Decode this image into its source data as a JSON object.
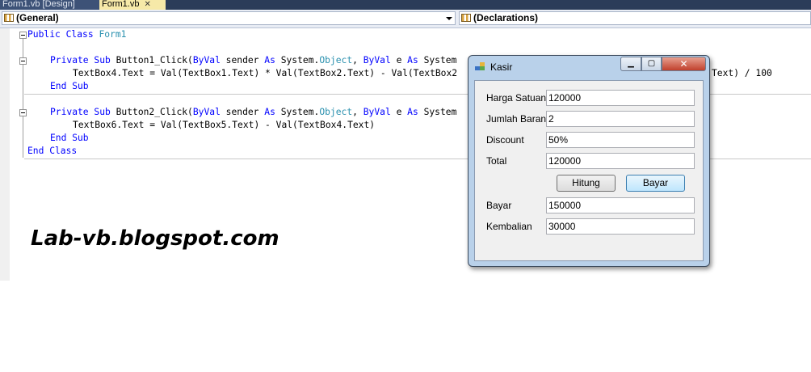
{
  "tabs": [
    {
      "label": "Form1.vb [Design]"
    },
    {
      "label": "Form1.vb"
    }
  ],
  "dropdowns": {
    "general": "(General)",
    "declarations": "(Declarations)"
  },
  "code": {
    "l1_kw": "Public Class",
    "l1_name": "Form1",
    "l3_a": "Private Sub",
    "l3_b": " Button1_Click(",
    "l3_c": "ByVal",
    "l3_d": " sender ",
    "l3_e": "As",
    "l3_f": " System.",
    "l3_g": "Object",
    "l3_h": ", ",
    "l3_i": "ByVal",
    "l3_j": " e ",
    "l3_k": "As",
    "l3_l": " System",
    "l4": "TextBox4.Text = Val(TextBox1.Text) * Val(TextBox2.Text) - Val(TextBox2",
    "l4_tail": "Text) / 100",
    "l5": "End Sub",
    "l7_a": "Private Sub",
    "l7_b": " Button2_Click(",
    "l7_c": "ByVal",
    "l7_d": " sender ",
    "l7_e": "As",
    "l7_f": " System.",
    "l7_g": "Object",
    "l7_h": ", ",
    "l7_i": "ByVal",
    "l7_j": " e ",
    "l7_k": "As",
    "l7_l": " System",
    "l8": "TextBox6.Text = Val(TextBox5.Text) - Val(TextBox4.Text)",
    "l9": "End Sub",
    "l10": "End Class"
  },
  "watermark": "Lab-vb.blogspot.com",
  "kasir": {
    "title": "Kasir",
    "fields": [
      {
        "label": "Harga Satuan",
        "value": "120000"
      },
      {
        "label": "Jumlah Barang",
        "value": "2"
      },
      {
        "label": "Discount",
        "value": "50%"
      },
      {
        "label": "Total",
        "value": "120000"
      },
      {
        "label": "Bayar",
        "value": "150000"
      },
      {
        "label": "Kembalian",
        "value": "30000"
      }
    ],
    "hitung_label": "Hitung",
    "bayar_label": "Bayar",
    "close_glyph": "✕",
    "min_glyph": "▁",
    "max_glyph": "▢"
  },
  "colors": {
    "keyword": "#0000ff",
    "type": "#2b91af",
    "window_frame": "#b9d1ea"
  }
}
